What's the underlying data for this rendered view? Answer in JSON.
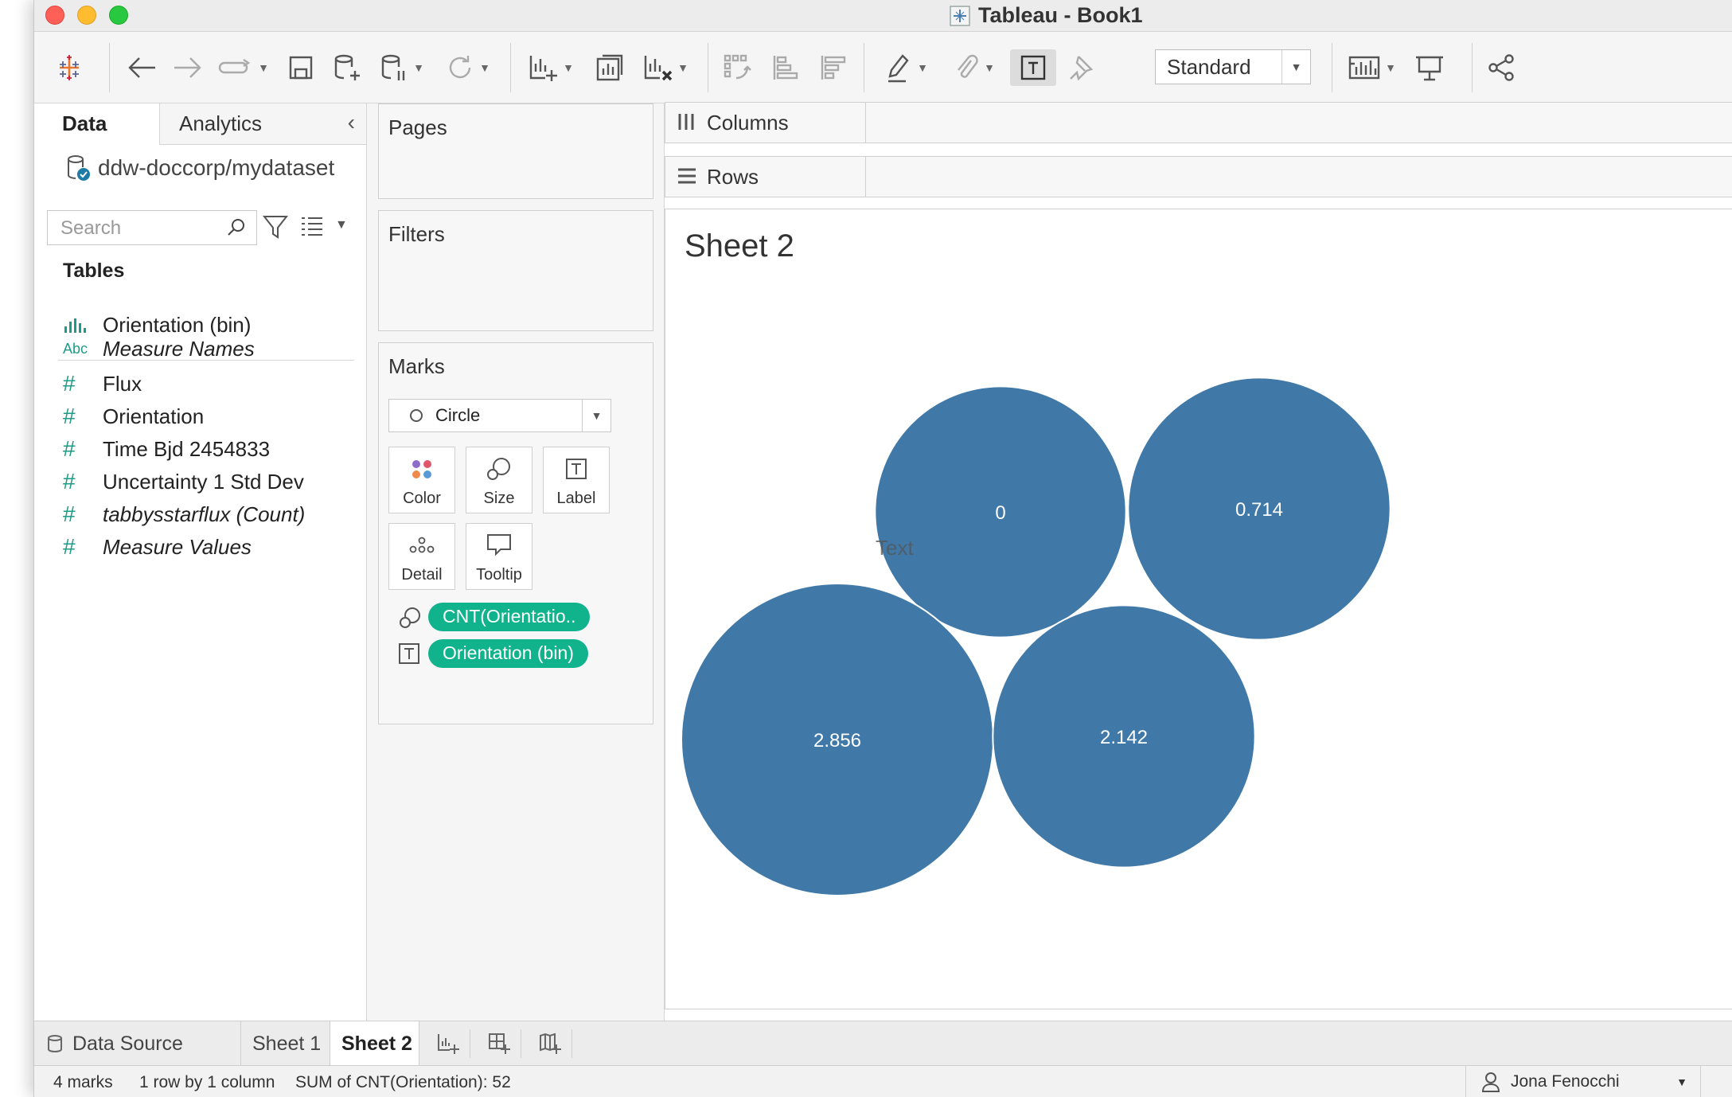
{
  "window": {
    "title": "Tableau - Book1"
  },
  "toolbar": {
    "presentation_mode": "Standard",
    "items": [
      "tableau-logo",
      "undo",
      "redo",
      "replay",
      "save",
      "new-datasource",
      "pause-updates",
      "refresh",
      "new-worksheet",
      "duplicate-sheet",
      "clear-sheet",
      "swap",
      "sort-asc",
      "sort-desc",
      "highlight",
      "group",
      "show-labels",
      "fix-axes",
      "fit",
      "show-me",
      "presentation",
      "share"
    ]
  },
  "datapane": {
    "tab_data": "Data",
    "tab_analytics": "Analytics",
    "datasource": "ddw-doccorp/mydataset",
    "search_placeholder": "Search",
    "tables_heading": "Tables",
    "dimensions": [
      {
        "icon": "histogram-icon",
        "label": "Orientation (bin)",
        "italic": false
      },
      {
        "icon": "abc-icon",
        "label": "Measure Names",
        "italic": true,
        "icon_text": "Abc"
      }
    ],
    "measures": [
      {
        "label": "Flux",
        "italic": false
      },
      {
        "label": "Orientation",
        "italic": false
      },
      {
        "label": "Time Bjd 2454833",
        "italic": false
      },
      {
        "label": "Uncertainty 1 Std Dev",
        "italic": false
      },
      {
        "label": "tabbysstarflux (Count)",
        "italic": true
      },
      {
        "label": "Measure Values",
        "italic": true
      }
    ]
  },
  "shelves": {
    "pages": "Pages",
    "filters": "Filters",
    "marks": "Marks",
    "mark_type": "Circle",
    "mark_buttons": [
      "Color",
      "Size",
      "Label",
      "Detail",
      "Tooltip"
    ],
    "pills": [
      {
        "icon": "size-icon",
        "label": "CNT(Orientatio.."
      },
      {
        "icon": "label-icon",
        "label": "Orientation (bin)"
      }
    ],
    "columns": "Columns",
    "rows": "Rows"
  },
  "view": {
    "sheet_title": "Sheet 2",
    "stray_text": "Text"
  },
  "chart_data": {
    "type": "packed-bubble",
    "title": "Sheet 2",
    "color": "#4079a8",
    "label_color": "#ffffff",
    "bubbles": [
      {
        "label": "0",
        "count": 11
      },
      {
        "label": "0.714",
        "count": 12
      },
      {
        "label": "2.856",
        "count": 17
      },
      {
        "label": "2.142",
        "count": 12
      }
    ],
    "total": 52
  },
  "sheet_tabs": {
    "data_source": "Data Source",
    "tabs": [
      "Sheet 1",
      "Sheet 2"
    ],
    "active": "Sheet 2"
  },
  "status": {
    "marks": "4 marks",
    "dims": "1 row by 1 column",
    "sum": "SUM of CNT(Orientation): 52",
    "user": "Jona Fenocchi"
  }
}
